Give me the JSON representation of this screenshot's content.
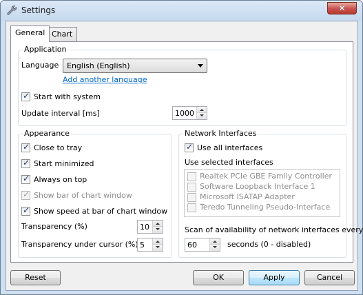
{
  "window": {
    "title": "Settings",
    "close_symbol": "✕"
  },
  "tabs": [
    {
      "label": "General"
    },
    {
      "label": "Chart"
    }
  ],
  "application": {
    "title": "Application",
    "language_label": "Language",
    "language_value": "English (English)",
    "add_language_link": "Add another language",
    "start_with_system": {
      "label": "Start with system",
      "checked": true
    },
    "update_interval_label": "Update interval [ms]",
    "update_interval_value": "1000"
  },
  "appearance": {
    "title": "Appearance",
    "close_to_tray": {
      "label": "Close to tray",
      "checked": true
    },
    "start_minimized": {
      "label": "Start minimized",
      "checked": true
    },
    "always_on_top": {
      "label": "Always on top",
      "checked": true
    },
    "show_bar": {
      "label": "Show bar of chart window",
      "checked": true,
      "disabled": true
    },
    "show_speed": {
      "label": "Show speed at bar of chart window",
      "checked": true
    },
    "transparency_label": "Transparency (%)",
    "transparency_value": "10",
    "transparency_cursor_label": "Transparency under cursor (%)",
    "transparency_cursor_value": "5"
  },
  "network": {
    "title": "Network Interfaces",
    "use_all": {
      "label": "Use all interfaces",
      "checked": true
    },
    "use_selected_label": "Use selected interfaces",
    "interfaces": [
      "Realtek PCIe GBE Family Controller",
      "Software Loopback Interface 1",
      "Microsoft ISATAP Adapter",
      "Teredo Tunneling Pseudo-Interface"
    ],
    "scan_label": "Scan of availability of network interfaces every",
    "scan_value": "60",
    "scan_suffix": "seconds (0 - disabled)"
  },
  "buttons": {
    "reset": "Reset",
    "ok": "OK",
    "apply": "Apply",
    "cancel": "Cancel"
  },
  "colors": {
    "link": "#0066cc",
    "window_frame": "#cfe0f1",
    "close_button": "#c75050"
  }
}
